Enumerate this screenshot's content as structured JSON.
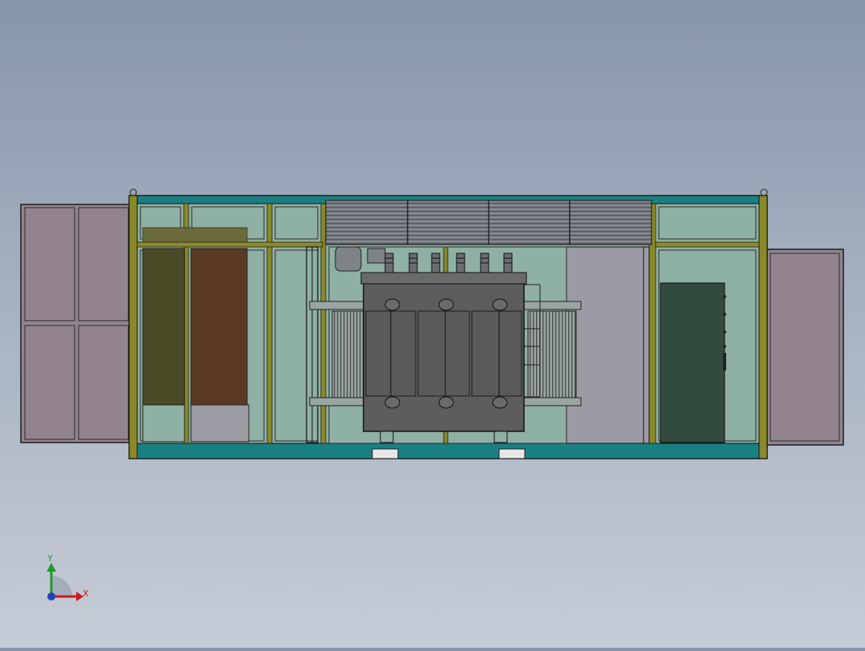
{
  "viewport": {
    "background_top": "#8795aa",
    "background_bottom": "#c6ccd6"
  },
  "triad": {
    "x_label": "X",
    "y_label": "Y",
    "x_color": "#c81e1e",
    "y_color": "#1f9a2a",
    "z_color": "#1f3fbf"
  },
  "colors": {
    "frame_teal": "#1b7f82",
    "frame_olive": "#8a8a28",
    "glass_panel": "#8fb0a4",
    "door_panel": "#92848e",
    "louver": "#6a6e74",
    "transformer_body": "#5d5d5f",
    "cabinet_olive": "#4a4a26",
    "cabinet_brown": "#5b3a25",
    "cabinet_dark_green": "#334a3f"
  },
  "model": {
    "name": "",
    "components": [
      "container-frame",
      "left-door",
      "right-door",
      "transformer",
      "switchgear-cabinets",
      "control-cabinet",
      "ventilation-louvers"
    ]
  }
}
